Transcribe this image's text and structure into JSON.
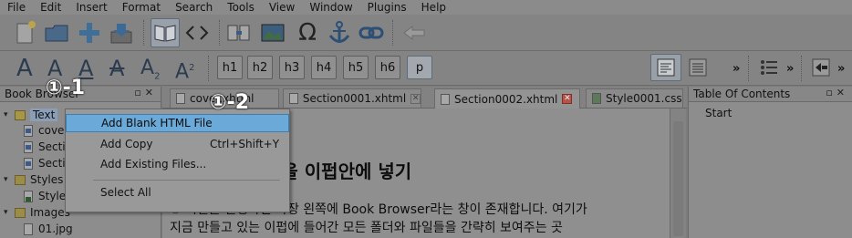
{
  "menu": [
    "File",
    "Edit",
    "Insert",
    "Format",
    "Search",
    "Tools",
    "View",
    "Window",
    "Plugins",
    "Help"
  ],
  "toolbar2": {
    "headings": [
      "h1",
      "h2",
      "h3",
      "h4",
      "h5",
      "h6",
      "p"
    ],
    "more": "»"
  },
  "book_browser": {
    "title": "Book Browser",
    "tree": [
      {
        "label": "Text",
        "kind": "folder"
      },
      {
        "label": "cover.xhtml",
        "kind": "xhtml"
      },
      {
        "label": "Section0001.xhtml",
        "kind": "xhtml"
      },
      {
        "label": "Section0002.xhtml",
        "kind": "xhtml"
      },
      {
        "label": "Styles",
        "kind": "folder"
      },
      {
        "label": "Style0001.css",
        "kind": "css"
      },
      {
        "label": "Images",
        "kind": "folder"
      },
      {
        "label": "01.jpg",
        "kind": "image"
      }
    ]
  },
  "tabs": [
    {
      "label": "cover.xhtml"
    },
    {
      "label": "Section0001.xhtml"
    },
    {
      "label": "Section0002.xhtml"
    },
    {
      "label": "Style0001.css"
    }
  ],
  "toc": {
    "title": "Table Of Contents",
    "items": [
      "Start"
    ]
  },
  "context_menu": [
    {
      "label": "Add Blank HTML File",
      "shortcut": ""
    },
    {
      "label": "Add Copy",
      "shortcut": "Ctrl+Shift+Y"
    },
    {
      "label": "Add Existing Files...",
      "shortcut": ""
    },
    {
      "label": "Select All",
      "shortcut": ""
    }
  ],
  "editor": {
    "heading": "일을 이펍안에 넣기",
    "line1": "① 시길을 실행하면 가장 왼쪽에 Book Browser라는 창이 존재합니다. 여기가",
    "line2": "지금 만들고 있는 이펍에 들어간 모든 폴더와 파일들을 간략히 보여주는 곳"
  },
  "annotations": [
    "①-1",
    "①-2"
  ]
}
